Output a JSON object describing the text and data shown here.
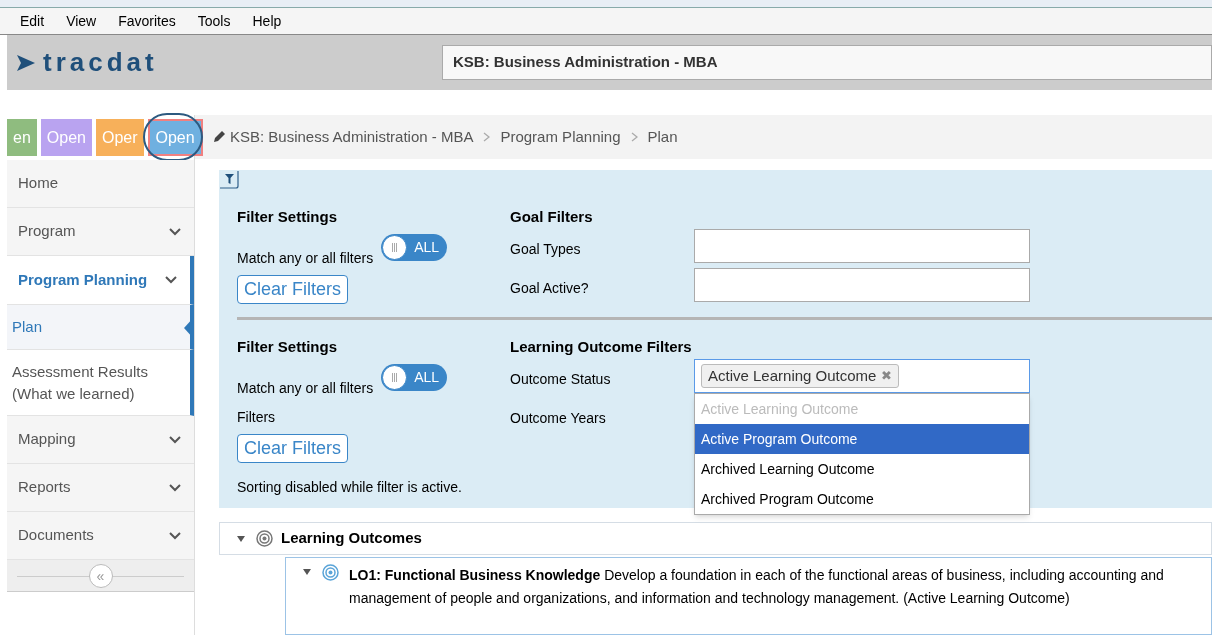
{
  "menu_bar": [
    "Edit",
    "View",
    "Favorites",
    "Tools",
    "Help"
  ],
  "header": {
    "logo": "tracdat",
    "title": "KSB: Business Administration - MBA"
  },
  "tabs": [
    {
      "label": "en",
      "color": "#8fbc7f",
      "circled": false
    },
    {
      "label": "Open",
      "color": "#b9a3f0",
      "circled": false
    },
    {
      "label": "Oper",
      "color": "#f7b05a",
      "circled": false
    },
    {
      "label": "Open",
      "color": "#6fb0e0",
      "circled": true
    }
  ],
  "sidebar": {
    "items": [
      {
        "label": "Home",
        "kind": "menu",
        "has_children": false,
        "selected": false
      },
      {
        "label": "Program",
        "kind": "menu",
        "has_children": true,
        "selected": false
      },
      {
        "label": "Program Planning",
        "kind": "menu",
        "has_children": true,
        "selected": true
      },
      {
        "label": "Plan",
        "kind": "sub",
        "has_children": false,
        "selected": true
      },
      {
        "label": "Assessment Results (What we learned)",
        "kind": "sub",
        "has_children": false,
        "selected": false
      },
      {
        "label": "Mapping",
        "kind": "menu",
        "has_children": true,
        "selected": false
      },
      {
        "label": "Reports",
        "kind": "menu",
        "has_children": true,
        "selected": false
      },
      {
        "label": "Documents",
        "kind": "menu",
        "has_children": true,
        "selected": false
      }
    ],
    "collapse": "«"
  },
  "breadcrumb": [
    "KSB: Business Administration - MBA",
    "Program Planning",
    "Plan"
  ],
  "filter_sections": [
    {
      "settings_title": "Filter Settings",
      "match_label": "Match any or all filters",
      "toggle": {
        "label": "ALL"
      },
      "clear_button": "Clear Filters",
      "filters_title": "Goal Filters",
      "fields": [
        {
          "label": "Goal Types",
          "covered": false
        },
        {
          "label": "Goal Active?",
          "covered": false
        }
      ]
    },
    {
      "settings_title": "Filter Settings",
      "match_label": "Match any or all filters",
      "match_extra": "Filters",
      "toggle": {
        "label": "ALL"
      },
      "clear_button": "Clear Filters",
      "note": "Sorting disabled while filter is active.",
      "filters_title": "Learning Outcome Filters",
      "fields": [
        {
          "label": "Outcome Status",
          "chips": [
            "Active Learning Outcome"
          ],
          "remove": "✖",
          "covered": false
        },
        {
          "label": "Outcome Years",
          "covered": true
        }
      ]
    }
  ],
  "dropdown": {
    "options": [
      {
        "label": "Active Learning Outcome",
        "disabled": true,
        "selected": false
      },
      {
        "label": "Active Program Outcome",
        "disabled": false,
        "selected": true
      },
      {
        "label": "Archived Learning Outcome",
        "disabled": false,
        "selected": false
      },
      {
        "label": "Archived Program Outcome",
        "disabled": false,
        "selected": false
      }
    ]
  },
  "tree": [
    {
      "label": "Learning Outcomes",
      "expanded": true,
      "children": [
        {
          "lines": [
            "**LO1: Functional Business Knowledge** Develop a foundation in each of the functional areas of business, including accounting and",
            "management of people and organizations, and information and technology management. (Active Learning Outcome)"
          ],
          "expanded": true
        }
      ]
    }
  ]
}
